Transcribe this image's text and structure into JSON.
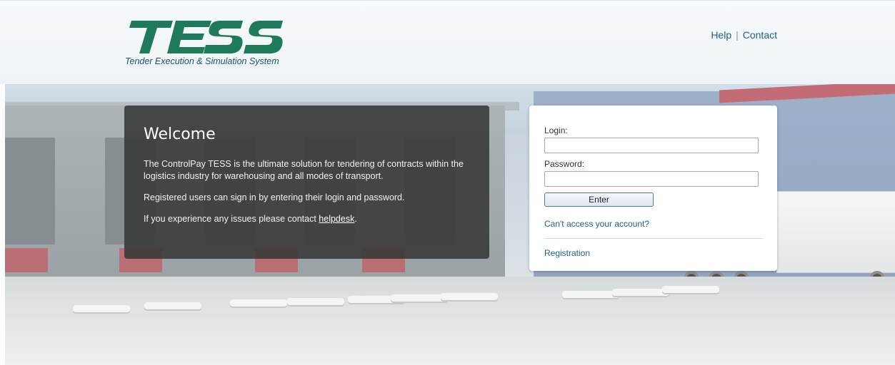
{
  "header": {
    "logo_text": "TESS",
    "logo_subtitle": "Tender Execution & Simulation System",
    "links": {
      "help": "Help",
      "separator": "|",
      "contact": "Contact"
    }
  },
  "welcome": {
    "title": "Welcome",
    "paragraph_1": "The ControlPay TESS is the ultimate solution for tendering of contracts within the logistics industry for warehousing and all modes of transport.",
    "paragraph_2": "Registered users can sign in by entering their login and password.",
    "paragraph_3_prefix": "If you experience any issues please contact ",
    "helpdesk_link": "helpdesk",
    "paragraph_3_suffix": "."
  },
  "login_form": {
    "login_label": "Login:",
    "login_value": "",
    "password_label": "Password:",
    "password_value": "",
    "enter_button": "Enter",
    "cant_access_link": "Can't access your account?",
    "registration_link": "Registration"
  },
  "colors": {
    "brand_green": "#1f7a5a",
    "link_blue": "#1f5f8f",
    "panel_dark": "#3a3a3a"
  }
}
